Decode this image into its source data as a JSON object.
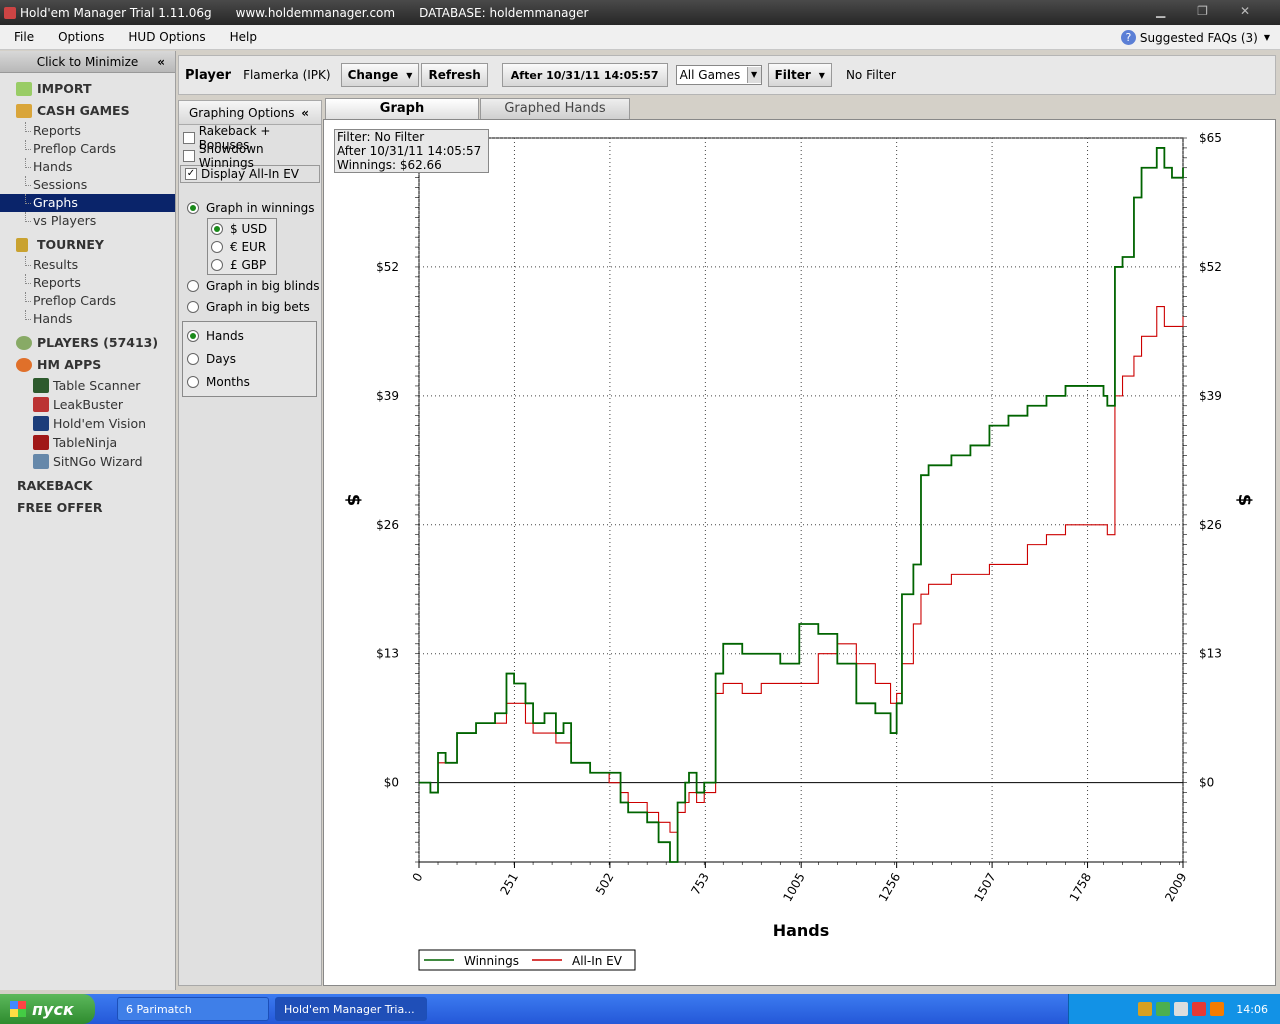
{
  "window": {
    "title": "Hold'em Manager Trial 1.11.06g",
    "site": "www.holdemmanager.com",
    "database": "DATABASE: holdemmanager"
  },
  "menu": [
    "File",
    "Options",
    "HUD Options",
    "Help"
  ],
  "faq": "Suggested FAQs (3)",
  "sidebar": {
    "minimize": "Click to Minimize",
    "import": "IMPORT",
    "cash_games": "CASH GAMES",
    "cash_items": [
      "Reports",
      "Preflop Cards",
      "Hands",
      "Sessions",
      "Graphs",
      "vs Players"
    ],
    "tourney": "TOURNEY",
    "tourney_items": [
      "Results",
      "Reports",
      "Preflop Cards",
      "Hands"
    ],
    "players": "PLAYERS (57413)",
    "hm_apps": "HM APPS",
    "apps": [
      "Table Scanner",
      "LeakBuster",
      "Hold'em Vision",
      "TableNinja",
      "SitNGo Wizard"
    ],
    "rakeback": "RAKEBACK",
    "free_offer": "FREE OFFER"
  },
  "player_bar": {
    "label": "Player",
    "name": "Flamerka (IPK)",
    "change": "Change",
    "refresh": "Refresh",
    "date": "After 10/31/11 14:05:57",
    "games": "All Games",
    "filter": "Filter",
    "filter_status": "No Filter"
  },
  "graph_options": {
    "header": "Graphing Options",
    "checks": [
      {
        "label": "Rakeback + Bonuses",
        "checked": false
      },
      {
        "label": "Showdown Winnings",
        "checked": false
      },
      {
        "label": "Display All-In EV",
        "checked": true
      }
    ],
    "winnings": "Graph in winnings",
    "currencies": [
      "$ USD",
      "€ EUR",
      "£ GBP"
    ],
    "big_blinds": "Graph in big blinds",
    "big_bets": "Graph in big bets",
    "xaxis_opts": [
      "Hands",
      "Days",
      "Months"
    ]
  },
  "tabs": [
    "Graph",
    "Graphed Hands"
  ],
  "infobox": [
    "Filter: No Filter",
    "After 10/31/11 14:05:57",
    "Winnings: $62.66"
  ],
  "chart_data": {
    "type": "line",
    "xlabel": "Hands",
    "ylabel": "$",
    "x_ticks": [
      0,
      251,
      502,
      753,
      1005,
      1256,
      1507,
      1758,
      2009
    ],
    "y_ticks": [
      "$0",
      "$13",
      "$26",
      "$39",
      "$52",
      "$65"
    ],
    "y_tick_values": [
      0,
      13,
      26,
      39,
      52,
      65
    ],
    "xlim": [
      0,
      2009
    ],
    "ylim": [
      -8,
      65
    ],
    "grid": true,
    "legend_position": "bottom-left",
    "series": [
      {
        "name": "Winnings",
        "color": "#006400",
        "x": [
          0,
          30,
          50,
          70,
          100,
          150,
          200,
          230,
          250,
          280,
          300,
          330,
          360,
          380,
          400,
          450,
          500,
          530,
          550,
          600,
          630,
          660,
          680,
          700,
          710,
          730,
          750,
          780,
          800,
          850,
          900,
          950,
          1000,
          1005,
          1050,
          1100,
          1150,
          1200,
          1240,
          1256,
          1270,
          1300,
          1320,
          1340,
          1400,
          1450,
          1500,
          1550,
          1600,
          1650,
          1700,
          1750,
          1800,
          1810,
          1830,
          1850,
          1880,
          1900,
          1920,
          1940,
          1960,
          1980,
          2009
        ],
        "y": [
          0,
          -1,
          3,
          2,
          5,
          6,
          7,
          11,
          10,
          8,
          6,
          7,
          5,
          6,
          2,
          1,
          1,
          -2,
          -3,
          -4,
          -6,
          -8,
          -2,
          0,
          1,
          -1,
          0,
          11,
          14,
          13,
          13,
          12,
          16,
          16,
          15,
          12,
          8,
          7,
          5,
          8,
          19,
          22,
          31,
          32,
          33,
          34,
          36,
          37,
          38,
          39,
          40,
          40,
          39,
          38,
          52,
          53,
          59,
          62,
          62,
          64,
          62,
          61,
          62
        ]
      },
      {
        "name": "All-In EV",
        "color": "#cc0000",
        "x": [
          0,
          30,
          50,
          70,
          100,
          150,
          200,
          230,
          250,
          280,
          300,
          330,
          360,
          380,
          400,
          450,
          500,
          530,
          550,
          600,
          630,
          660,
          680,
          700,
          710,
          730,
          750,
          780,
          800,
          850,
          900,
          950,
          1000,
          1005,
          1050,
          1100,
          1150,
          1200,
          1240,
          1256,
          1270,
          1300,
          1320,
          1340,
          1400,
          1450,
          1500,
          1550,
          1600,
          1650,
          1700,
          1750,
          1800,
          1810,
          1830,
          1850,
          1880,
          1900,
          1920,
          1940,
          1960,
          1980,
          2009
        ],
        "y": [
          0,
          -1,
          2,
          2,
          5,
          6,
          6,
          8,
          8,
          6,
          5,
          5,
          4,
          4,
          2,
          1,
          0,
          -1,
          -2,
          -3,
          -4,
          -5,
          -3,
          -2,
          -1,
          -2,
          -1,
          9,
          10,
          9,
          10,
          10,
          10,
          10,
          13,
          14,
          12,
          10,
          8,
          9,
          12,
          16,
          19,
          20,
          21,
          21,
          22,
          22,
          24,
          25,
          26,
          26,
          26,
          25,
          39,
          41,
          43,
          45,
          45,
          48,
          46,
          46,
          47
        ]
      }
    ]
  },
  "taskbar": {
    "start": "пуск",
    "task1": "6 Parimatch",
    "task2": "Hold'em Manager Tria...",
    "clock": "14:06"
  }
}
